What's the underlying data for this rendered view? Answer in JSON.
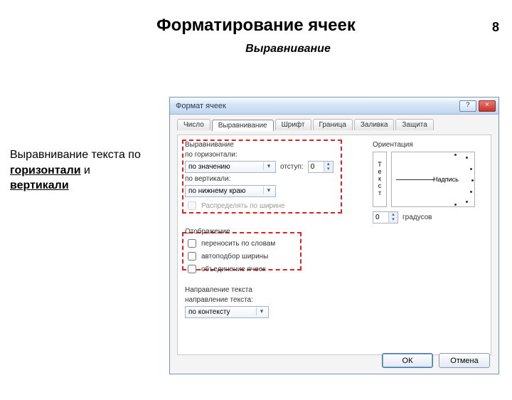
{
  "slide": {
    "number": "8",
    "title": "Форматирование ячеек",
    "subtitle": "Выравнивание",
    "caption_prefix": "Выравнивание текста по ",
    "caption_h": "горизонтали",
    "caption_and": " и ",
    "caption_v": "вертикали"
  },
  "dialog": {
    "title": "Формат ячеек",
    "help": "?",
    "close": "×",
    "tabs": [
      "Число",
      "Выравнивание",
      "Шрифт",
      "Граница",
      "Заливка",
      "Защита"
    ],
    "group_align": "Выравнивание",
    "lbl_horiz": "по горизонтали:",
    "val_horiz": "по значению",
    "lbl_indent": "отступ:",
    "val_indent": "0",
    "lbl_vert": "по вертикали:",
    "val_vert": "по нижнему краю",
    "chk_justify": "Распределять по ширине",
    "group_display": "Отображение",
    "chk_wrap": "переносить по словам",
    "chk_shrink": "автоподбор ширины",
    "chk_merge": "объединение ячеек",
    "group_dir": "Направление текста",
    "lbl_dir": "направление текста:",
    "val_dir": "по контексту",
    "orient_label": "Ориентация",
    "orient_vchars": [
      "Т",
      "е",
      "к",
      "с",
      "т"
    ],
    "orient_word": "Надпись",
    "deg_val": "0",
    "deg_label": "градусов",
    "ok": "ОК",
    "cancel": "Отмена"
  }
}
